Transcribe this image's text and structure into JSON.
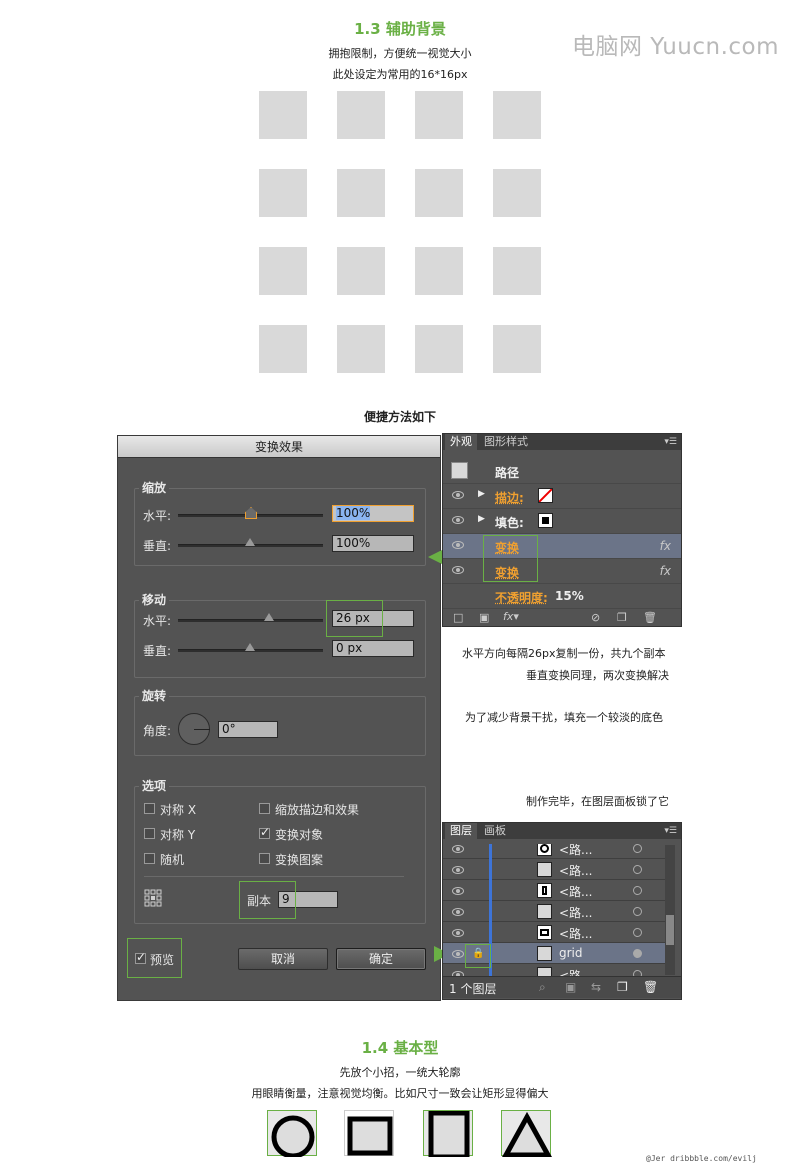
{
  "section1": {
    "title": "1.3 辅助背景",
    "line1": "拥抱限制，方便统一视觉大小",
    "line2": "此处设定为常用的16*16px"
  },
  "watermark": "电脑网 Yuucn.com",
  "shortcut_title": "便捷方法如下",
  "dialog": {
    "title": "变换效果",
    "scale": {
      "label": "缩放",
      "horizontal_label": "水平:",
      "horizontal_value": "100%",
      "vertical_label": "垂直:",
      "vertical_value": "100%"
    },
    "move": {
      "label": "移动",
      "horizontal_label": "水平:",
      "horizontal_value": "26 px",
      "vertical_label": "垂直:",
      "vertical_value": "0 px"
    },
    "rotate": {
      "label": "旋转",
      "angle_label": "角度:",
      "angle_value": "0°"
    },
    "options": {
      "label": "选项",
      "reflect_x": "对称 X",
      "reflect_y": "对称 Y",
      "random": "随机",
      "scale_strokes": "缩放描边和效果",
      "transform_objects": "变换对象",
      "transform_patterns": "变换图案",
      "copies_label": "副本",
      "copies_value": "9"
    },
    "preview_label": "预览",
    "cancel_label": "取消",
    "ok_label": "确定"
  },
  "appearance": {
    "tabs": [
      "外观",
      "图形样式"
    ],
    "header": "路径",
    "stroke_label": "描边:",
    "fill_label": "填色:",
    "transform1": "变换",
    "transform2": "变换",
    "opacity_label": "不透明度:",
    "opacity_value": "15%",
    "fx": "fx"
  },
  "notes": {
    "n1": "水平方向每隔26px复制一份，共九个副本",
    "n2": "垂直变换同理，两次变换解决",
    "n3": "为了减少背景干扰，填充一个较淡的底色",
    "n4": "制作完毕，在图层面板锁了它"
  },
  "layers": {
    "tabs": [
      "图层",
      "画板"
    ],
    "rows": [
      "<路...",
      "<路...",
      "<路...",
      "<路...",
      "<路...",
      "grid",
      "<路..."
    ],
    "footer": "1 个图层"
  },
  "section2": {
    "title": "1.4 基本型",
    "line1": "先放个小招，一统大轮廓",
    "line2": "用眼睛衡量，注意视觉均衡。比如尺寸一致会让矩形显得偏大"
  },
  "credit": "@Jer  dribbble.com/evilj",
  "colors": {
    "accent_green": "#6ab045",
    "panel_gray": "#535353",
    "layer_blue": "#3d74d8",
    "orange": "#f0a030"
  }
}
